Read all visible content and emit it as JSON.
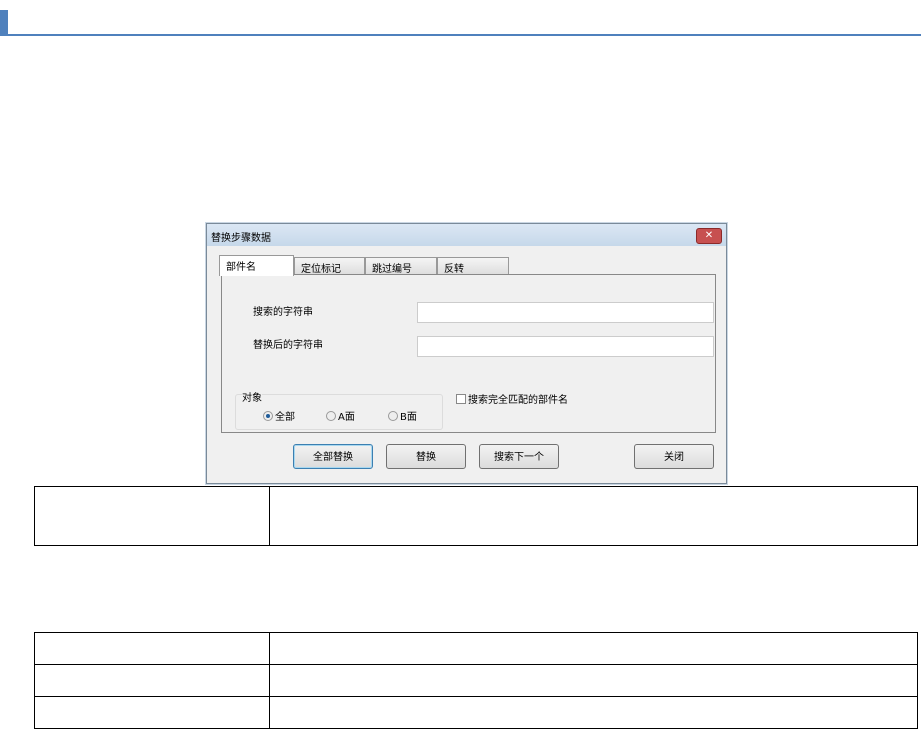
{
  "dialog": {
    "title": "替换步骤数据",
    "close": "✕",
    "tabs": [
      "部件名",
      "定位标记",
      "跳过编号",
      "反转"
    ],
    "search_label": "搜索的字符串",
    "search_value": "",
    "replace_label": "替换后的字符串",
    "replace_value": "",
    "target_group": "对象",
    "radios": [
      "全部",
      "A面",
      "B面"
    ],
    "checkbox": "搜索完全匹配的部件名",
    "buttons": [
      "全部替换",
      "替换",
      "搜索下一个",
      "关闭"
    ]
  }
}
